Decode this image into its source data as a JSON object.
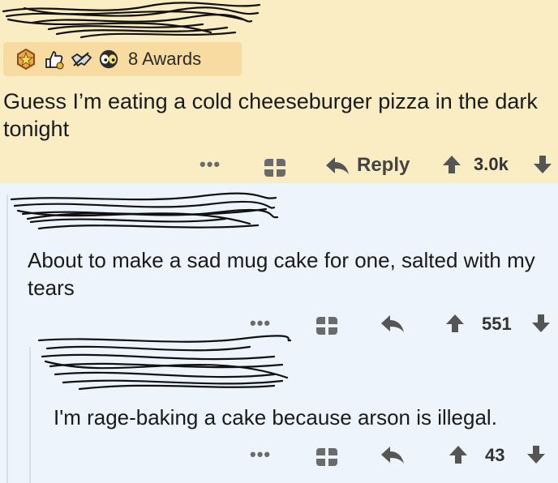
{
  "comments": [
    {
      "awards_label": "8 Awards",
      "awards": [
        "rocket-award-icon",
        "thumbs-up-award-icon",
        "handshake-award-icon",
        "eyes-award-icon"
      ],
      "body": "Guess I’m eating a cold cheeseburger pizza in the dark tonight",
      "reply_label": "Reply",
      "score": "3.0k"
    },
    {
      "body": "About to make a sad mug cake for one, salted with my tears",
      "score": "551"
    },
    {
      "body": "I'm rage-baking a cake because arson is illegal.",
      "score": "43"
    }
  ],
  "colors": {
    "highlight_bg": "#fbedc3",
    "awards_bg": "#f7dba1",
    "page_bg": "#edf4fb",
    "icon": "#555555"
  }
}
